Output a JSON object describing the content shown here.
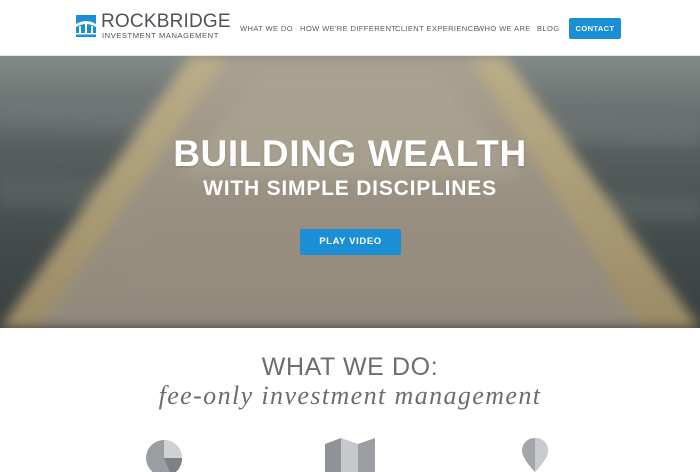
{
  "brand": {
    "name": "ROCKBRIDGE",
    "tagline": "INVESTMENT MANAGEMENT",
    "accent_color": "#1a8fd6",
    "logo_icon": "bridge-logo-icon"
  },
  "nav": {
    "items": [
      {
        "label": "WHAT WE DO"
      },
      {
        "label": "HOW WE'RE DIFFERENT"
      },
      {
        "label": "CLIENT EXPERIENCE"
      },
      {
        "label": "WHO WE ARE"
      },
      {
        "label": "BLOG"
      }
    ],
    "contact_label": "CONTACT"
  },
  "hero": {
    "title": "BUILDING WEALTH",
    "subtitle": "WITH SIMPLE DISCIPLINES",
    "cta_label": "PLAY VIDEO"
  },
  "what_we_do": {
    "title": "WHAT WE DO:",
    "subtitle": "fee-only investment management",
    "icons": [
      "pie-chart-icon",
      "map-icon",
      "location-pin-icon"
    ]
  }
}
